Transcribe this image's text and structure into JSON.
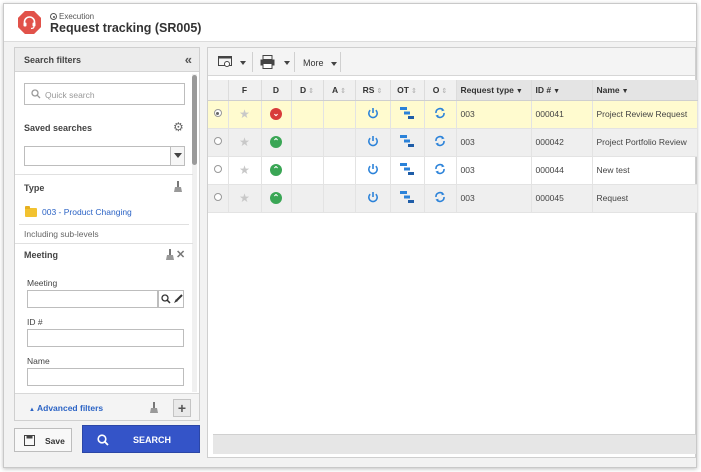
{
  "header": {
    "breadcrumb": "Execution",
    "title": "Request tracking (SR005)"
  },
  "filters": {
    "title": "Search filters",
    "quick_search_placeholder": "Quick search",
    "saved_searches_label": "Saved searches",
    "saved_searches_value": "",
    "type_label": "Type",
    "type_value": "003 - Product Changing",
    "including_sub_levels": "Including sub-levels",
    "meeting_section": "Meeting",
    "meeting_label": "Meeting",
    "meeting_value": "",
    "id_label": "ID #",
    "id_value": "",
    "name_label": "Name",
    "name_value": "",
    "advanced_filters": "Advanced filters"
  },
  "buttons": {
    "save": "Save",
    "search": "SEARCH"
  },
  "toolbar": {
    "more": "More"
  },
  "grid": {
    "columns": [
      "",
      "F",
      "D",
      "D",
      "A",
      "RS",
      "OT",
      "O",
      "Request type",
      "ID #",
      "Name"
    ],
    "rows": [
      {
        "selected": true,
        "status": "late",
        "request_type": "003",
        "id": "000041",
        "name": "Project Review Request"
      },
      {
        "selected": false,
        "status": "on-time",
        "request_type": "003",
        "id": "000042",
        "name": "Project Portfolio Review"
      },
      {
        "selected": false,
        "status": "on-time",
        "request_type": "003",
        "id": "000044",
        "name": "New test"
      },
      {
        "selected": false,
        "status": "on-time",
        "request_type": "003",
        "id": "000045",
        "name": "Request"
      }
    ]
  },
  "colors": {
    "accent": "#3454c8",
    "logo": "#e1524a",
    "status_late": "#d83b3b",
    "status_on_time": "#3aa655",
    "selected_row": "#fffbcf",
    "link": "#2b63c5",
    "icon_blue": "#2b82d9"
  },
  "icons": [
    "headset-logo-icon",
    "search-icon",
    "gear-icon",
    "broom-icon",
    "close-icon",
    "folder-icon",
    "plus-icon",
    "save-icon",
    "print-icon",
    "view-icon",
    "power-icon",
    "gantt-icon",
    "refresh-icon",
    "star-icon",
    "collapse-icon"
  ]
}
